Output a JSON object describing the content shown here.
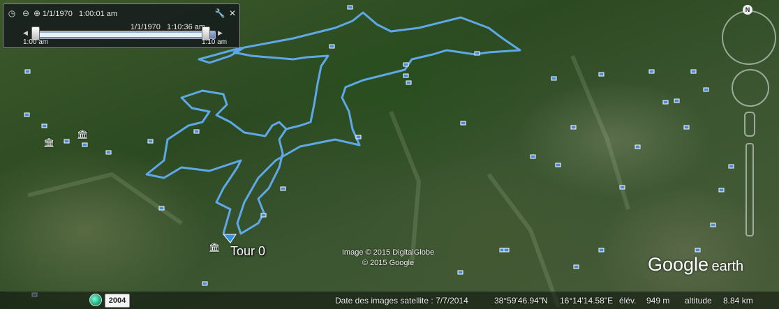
{
  "time_slider": {
    "start_label": "1/1/1970",
    "start_time": "1:00:01 am",
    "current_label": "1/1/1970",
    "current_time": "1:10:36 am",
    "range_start": "1:00 am",
    "range_end": "1:10 am",
    "progress": 1.0
  },
  "map": {
    "tour_label": "Tour 0",
    "copyright_line1": "Image © 2015 DigitalGlobe",
    "copyright_line2": "© 2015 Google",
    "route_color": "#5fa8e8"
  },
  "logo": {
    "google": "Google",
    "earth": "earth"
  },
  "status_bar": {
    "historical_year": "2004",
    "imagery_date": "Date des images satellite : 7/7/2014",
    "latitude": "38°59'46.94\"N",
    "longitude": "16°14'14.58\"E",
    "elevation_label": "élév.",
    "elevation_value": "949 m",
    "altitude_label": "altitude",
    "altitude_value": "8.84 km"
  },
  "nav": {
    "north_label": "N"
  },
  "icons": {
    "clock": "clock-icon",
    "zoom_in": "zoom-in-icon",
    "zoom_out": "zoom-out-icon",
    "settings": "wrench-icon",
    "close": "close-icon",
    "tour_marker": "tour-marker-icon"
  }
}
